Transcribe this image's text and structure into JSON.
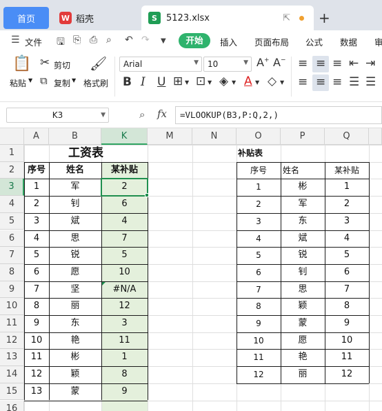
{
  "tabs": {
    "home": "首页",
    "daoke": "稻壳",
    "file": "5123.xlsx",
    "file_logo": "S",
    "daoke_logo": "W"
  },
  "menu": {
    "file_label": "文件",
    "items": [
      "开始",
      "插入",
      "页面布局",
      "公式",
      "数据",
      "审"
    ]
  },
  "ribbon": {
    "paste": "粘贴",
    "cut": "剪切",
    "copy": "复制",
    "format_brush": "格式刷",
    "font_name": "Arial",
    "font_size": "10"
  },
  "formula_bar": {
    "cell_ref": "K3",
    "fx": "fx",
    "formula": "=VLOOKUP(B3,P:Q,2,)"
  },
  "grid": {
    "columns": [
      "A",
      "B",
      "K",
      "M",
      "N",
      "O",
      "P",
      "Q"
    ],
    "rows": [
      "1",
      "2",
      "3",
      "4",
      "5",
      "6",
      "7",
      "8",
      "9",
      "10",
      "11",
      "12",
      "13",
      "14",
      "15",
      "16"
    ],
    "selected_column": "K",
    "selected_row": "3"
  },
  "left_table": {
    "title": "工资表",
    "headers": [
      "序号",
      "姓名",
      "某补贴"
    ],
    "rows": [
      [
        "1",
        "军",
        "2"
      ],
      [
        "2",
        "钊",
        "6"
      ],
      [
        "3",
        "斌",
        "4"
      ],
      [
        "4",
        "思",
        "7"
      ],
      [
        "5",
        "锐",
        "5"
      ],
      [
        "6",
        "愿",
        "10"
      ],
      [
        "7",
        "坚",
        "#N/A"
      ],
      [
        "8",
        "丽",
        "12"
      ],
      [
        "9",
        "东",
        "3"
      ],
      [
        "10",
        "艳",
        "11"
      ],
      [
        "11",
        "彬",
        "1"
      ],
      [
        "12",
        "颖",
        "8"
      ],
      [
        "13",
        "蒙",
        "9"
      ]
    ]
  },
  "right_table": {
    "title": "补贴表",
    "headers": [
      "序号",
      "姓名",
      "某补贴"
    ],
    "rows": [
      [
        "1",
        "彬",
        "1"
      ],
      [
        "2",
        "军",
        "2"
      ],
      [
        "3",
        "东",
        "3"
      ],
      [
        "4",
        "斌",
        "4"
      ],
      [
        "5",
        "锐",
        "5"
      ],
      [
        "6",
        "钊",
        "6"
      ],
      [
        "7",
        "思",
        "7"
      ],
      [
        "8",
        "颖",
        "8"
      ],
      [
        "9",
        "蒙",
        "9"
      ],
      [
        "10",
        "愿",
        "10"
      ],
      [
        "11",
        "艳",
        "11"
      ],
      [
        "12",
        "丽",
        "12"
      ]
    ]
  },
  "colors": {
    "accent_green": "#2fb36d",
    "tab_blue": "#4a8df6",
    "selection_fill": "#e4f0dc"
  }
}
